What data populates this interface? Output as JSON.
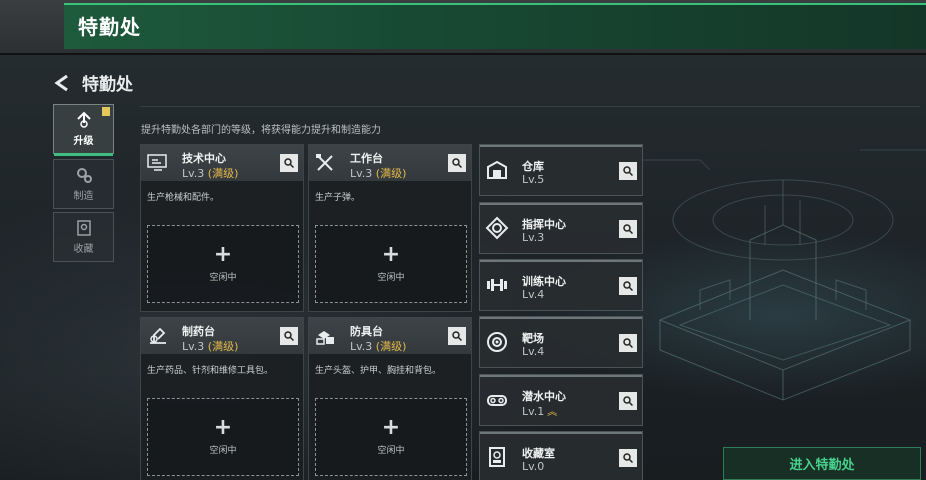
{
  "header": {
    "title": "特勤处"
  },
  "nav": {
    "back_icon": "back-arrow-icon",
    "title": "特勤处"
  },
  "tabs": [
    {
      "label": "升级",
      "icon": "upgrade-icon",
      "active": true
    },
    {
      "label": "制造",
      "icon": "gears-icon",
      "active": false
    },
    {
      "label": "收藏",
      "icon": "collection-icon",
      "active": false
    }
  ],
  "description": "提升特勤处各部门的等级，将获得能力提升和制造能力",
  "departments": [
    {
      "name": "技术中心",
      "level": "Lv.3",
      "max": "(满级)",
      "desc": "生产枪械和配件。",
      "slot_plus": "+",
      "slot_status": "空闲中",
      "icon": "tech-center-icon"
    },
    {
      "name": "工作台",
      "level": "Lv.3",
      "max": "(满级)",
      "desc": "生产子弹。",
      "slot_plus": "+",
      "slot_status": "空闲中",
      "icon": "workbench-icon"
    },
    {
      "name": "制药台",
      "level": "Lv.3",
      "max": "(满级)",
      "desc": "生产药品、针剂和维修工具包。",
      "slot_plus": "+",
      "slot_status": "空闲中",
      "icon": "pharmacy-icon"
    },
    {
      "name": "防具台",
      "level": "Lv.3",
      "max": "(满级)",
      "desc": "生产头盔、护甲、胸挂和背包。",
      "slot_plus": "+",
      "slot_status": "空闲中",
      "icon": "armor-bench-icon"
    }
  ],
  "facilities": [
    {
      "name": "仓库",
      "level": "Lv.5",
      "icon": "warehouse-icon"
    },
    {
      "name": "指挥中心",
      "level": "Lv.3",
      "icon": "command-center-icon"
    },
    {
      "name": "训练中心",
      "level": "Lv.4",
      "icon": "training-center-icon"
    },
    {
      "name": "靶场",
      "level": "Lv.4",
      "icon": "shooting-range-icon"
    },
    {
      "name": "潜水中心",
      "level": "Lv.1",
      "upgradeable": true,
      "icon": "diving-center-icon"
    },
    {
      "name": "收藏室",
      "level": "Lv.0",
      "icon": "collection-room-icon"
    }
  ],
  "enter_button": {
    "label": "进入特勤处"
  },
  "colors": {
    "accent_green": "#3fbf7f",
    "max_level_gold": "#e3b94c"
  }
}
